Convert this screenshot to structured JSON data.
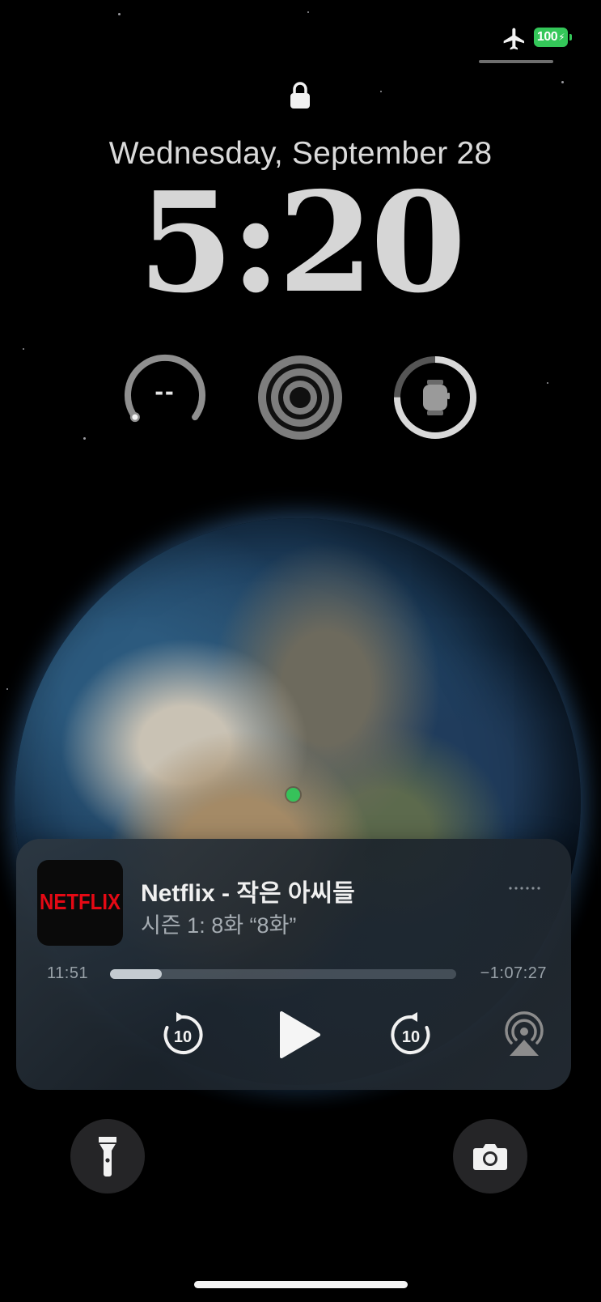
{
  "status_bar": {
    "airplane_icon": "airplane-icon",
    "battery_level": "100",
    "battery_color": "#34c759"
  },
  "lock_screen": {
    "lock_icon": "lock-icon",
    "date": "Wednesday, September 28",
    "time": "5:20"
  },
  "widgets": [
    {
      "name": "gauge-widget",
      "value": "--"
    },
    {
      "name": "activity-rings-widget",
      "icon": "concentric-rings-icon"
    },
    {
      "name": "watch-battery-widget",
      "icon": "apple-watch-icon",
      "level": 0.75
    }
  ],
  "location": {
    "dot_color": "#36c25a"
  },
  "now_playing": {
    "artwork_text": "NETFLIX",
    "artwork_color": "#e50914",
    "title": "Netflix - 작은 아씨들",
    "subtitle": "시즌 1: 8화 “8화”",
    "elapsed": "11:51",
    "remaining": "−1:07:27",
    "progress": 0.15,
    "controls": {
      "skip_back_label": "10",
      "skip_forward_label": "10",
      "play_icon": "play-icon",
      "airplay_icon": "airplay-audio-icon",
      "more_icon": "more-dots-icon"
    }
  },
  "quick_actions": {
    "flashlight_icon": "flashlight-icon",
    "camera_icon": "camera-icon"
  }
}
